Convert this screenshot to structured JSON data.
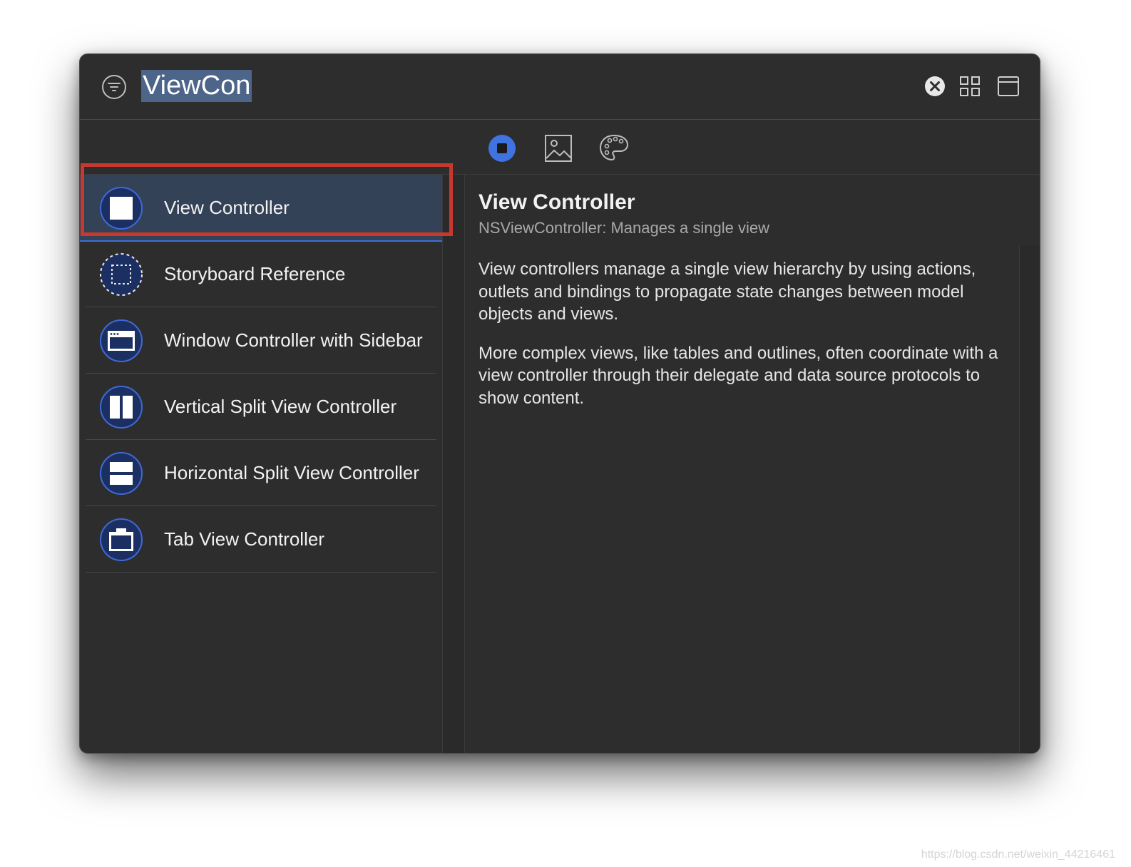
{
  "search": {
    "query": "ViewCon"
  },
  "library_tabs": [
    {
      "name": "Objects",
      "icon": "object-library-icon",
      "selected": true
    },
    {
      "name": "Media",
      "icon": "media-library-icon",
      "selected": false
    },
    {
      "name": "Colors",
      "icon": "color-library-icon",
      "selected": false
    }
  ],
  "results": [
    {
      "label": "View Controller",
      "icon": "view-controller-icon",
      "selected": true
    },
    {
      "label": "Storyboard Reference",
      "icon": "storyboard-reference-icon",
      "selected": false
    },
    {
      "label": "Window Controller with Sidebar",
      "icon": "window-controller-icon",
      "selected": false
    },
    {
      "label": "Vertical Split View Controller",
      "icon": "vertical-split-icon",
      "selected": false
    },
    {
      "label": "Horizontal Split View Controller",
      "icon": "horizontal-split-icon",
      "selected": false
    },
    {
      "label": "Tab View Controller",
      "icon": "tab-view-icon",
      "selected": false
    }
  ],
  "detail": {
    "title": "View Controller",
    "subtitle": "NSViewController: Manages a single view",
    "paragraphs": [
      "View controllers manage a single view hierarchy by using actions, outlets and bindings to propagate state changes between model objects and views.",
      "More complex views, like tables and outlines, often coordinate with a view controller through their delegate and data source protocols to show content."
    ]
  },
  "watermark": "https://blog.csdn.net/weixin_44216461",
  "colors": {
    "window_bg": "#2e2d2d",
    "selection": "#344258",
    "accent": "#3f6fd6",
    "icon_circle": "#1c2f63",
    "annotation": "#c8382d"
  }
}
